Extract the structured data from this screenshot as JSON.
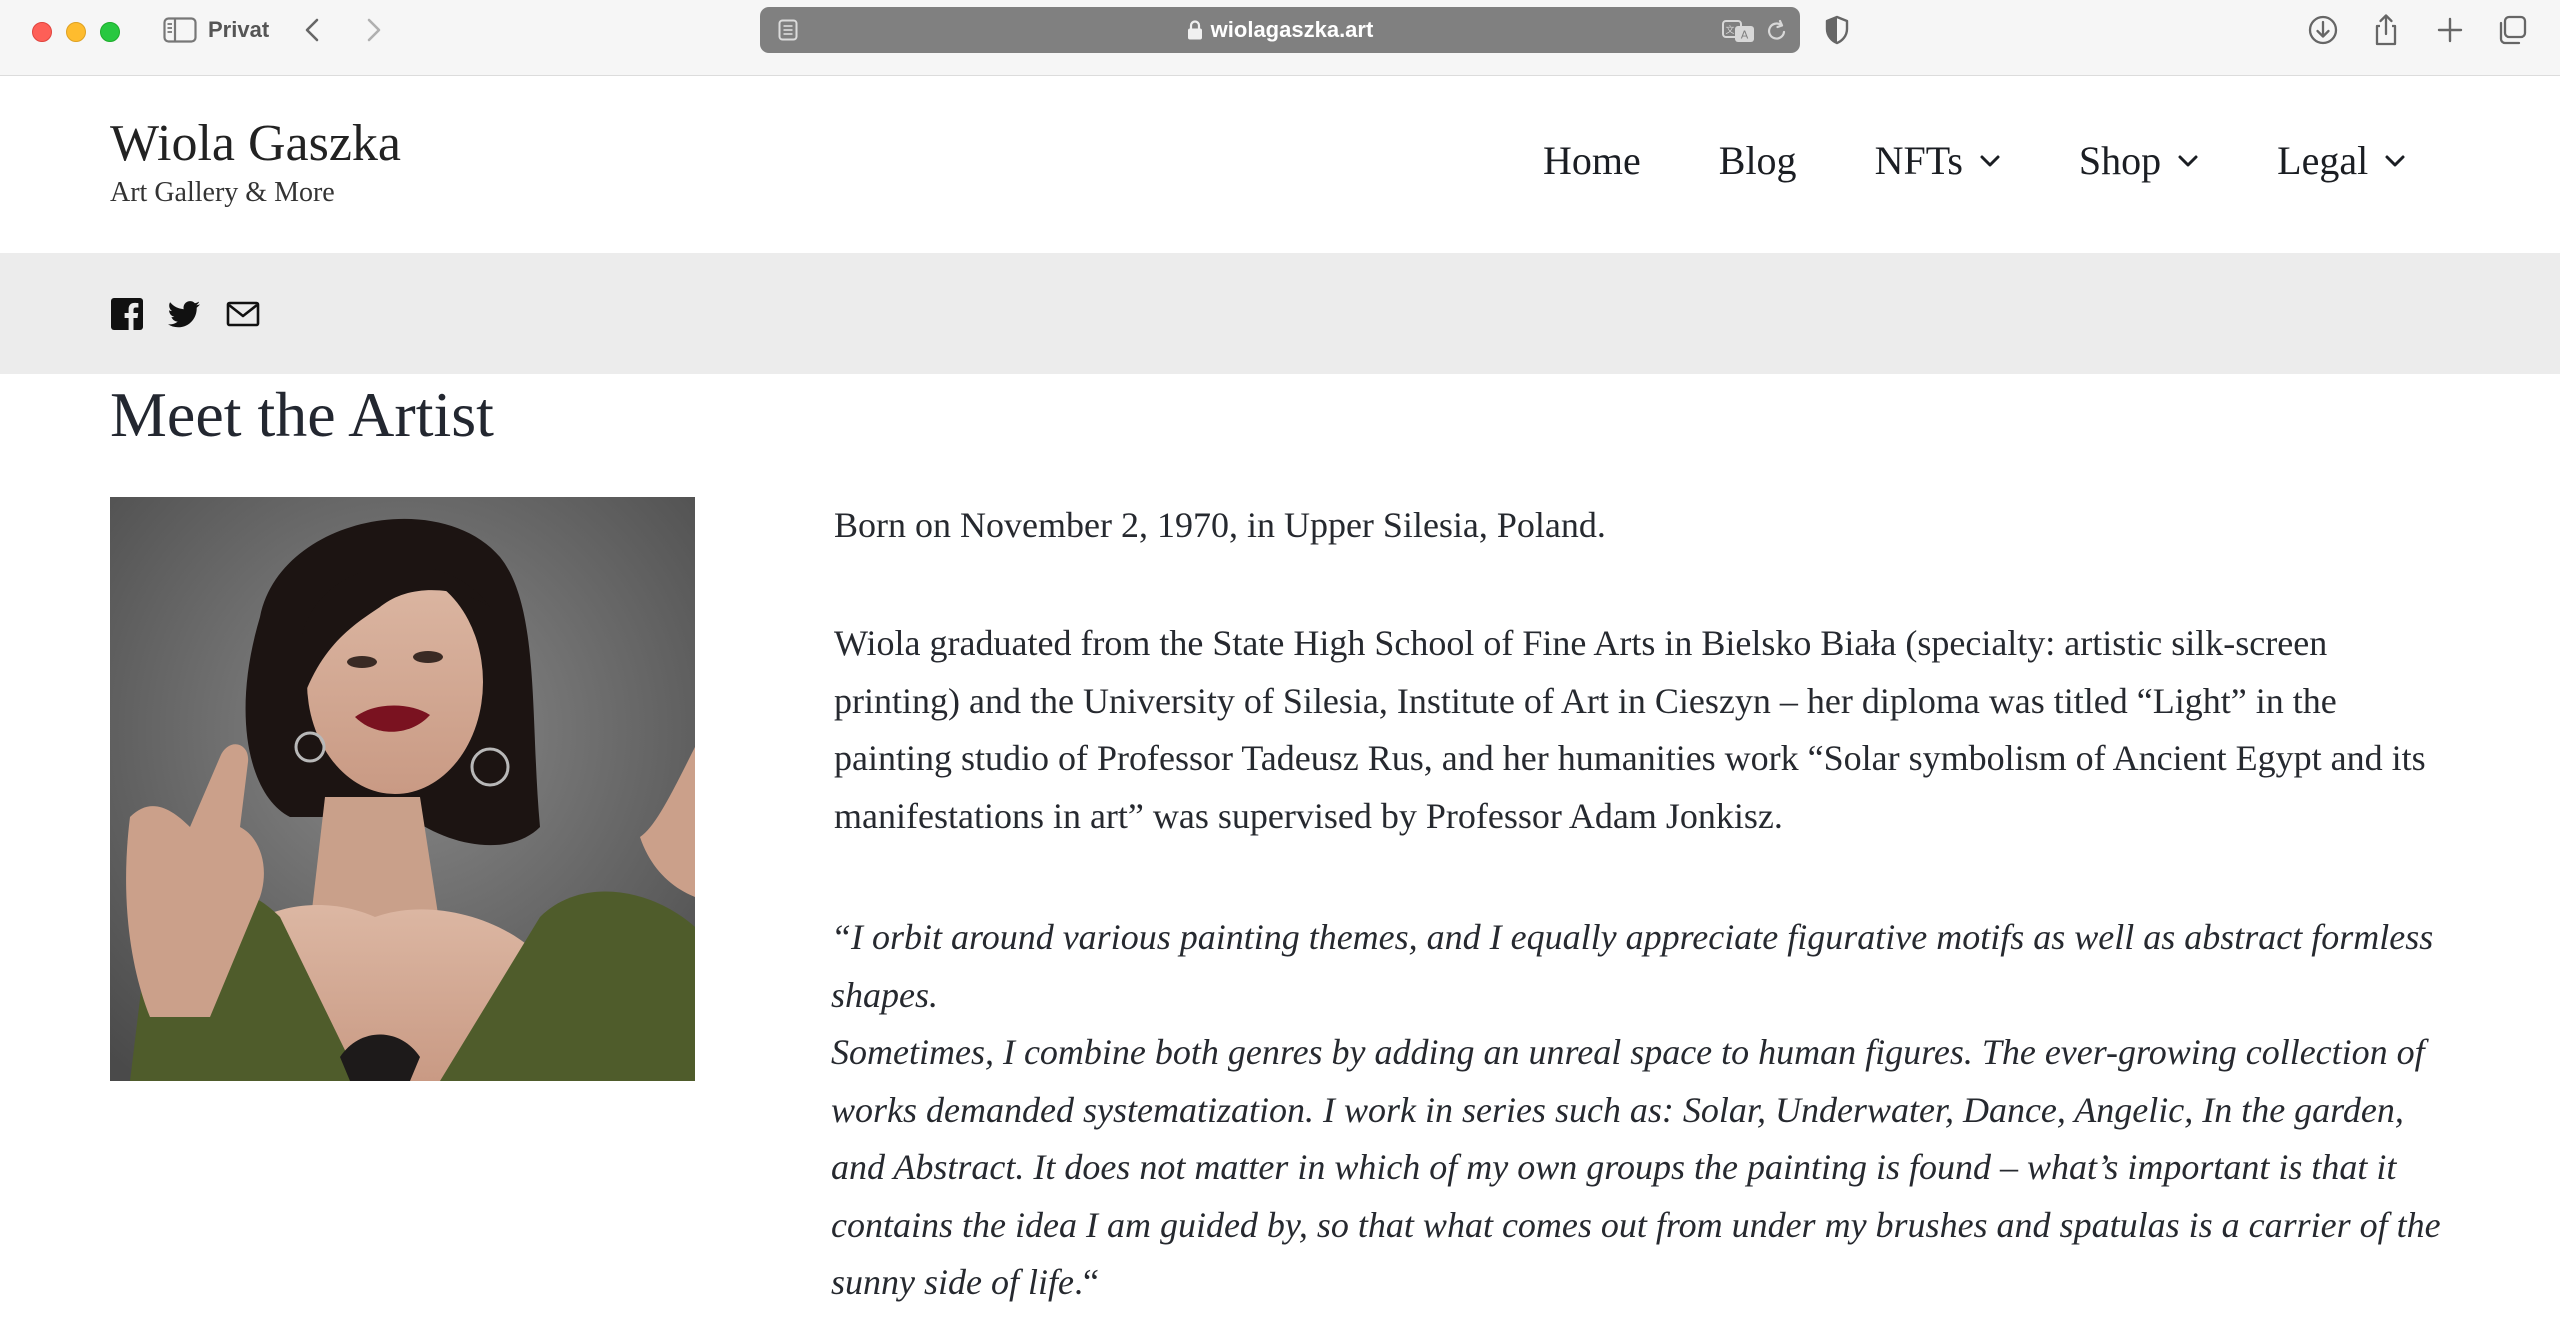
{
  "browser": {
    "profile_label": "Privat",
    "url": "wiolagaszka.art"
  },
  "site": {
    "title": "Wiola Gaszka",
    "tagline": "Art Gallery & More",
    "nav": [
      {
        "label": "Home",
        "dropdown": false
      },
      {
        "label": "Blog",
        "dropdown": false
      },
      {
        "label": "NFTs",
        "dropdown": true
      },
      {
        "label": "Shop",
        "dropdown": true
      },
      {
        "label": "Legal",
        "dropdown": true
      }
    ],
    "social": [
      "facebook-icon",
      "twitter-icon",
      "email-icon"
    ]
  },
  "page": {
    "title": "Meet the Artist",
    "born": "Born on November 2, 1970, in Upper Silesia, Poland.",
    "bio": "Wiola graduated from the State High School of Fine Arts in Bielsko Biała (specialty: artistic silk-screen printing) and the University of Silesia, Institute of Art in Cieszyn – her diploma was titled “Light” in the painting studio of Professor Tadeusz Rus, and her humanities work “Solar symbolism of Ancient Egypt and its manifestations in art” was supervised by Professor Adam Jonkisz.",
    "quote_1": "“I orbit around various painting themes, and I equally appreciate figurative motifs as well as abstract formless shapes.",
    "quote_2": "Sometimes, I combine both genres by adding an unreal space to human figures. The ever-growing collection of works demanded systematization. I work in series such as: Solar, Underwater, Dance, Angelic, In the garden, and Abstract. It does not matter in which of my own groups the painting is found – what’s important is that it contains the idea I am guided by, so that what comes out from under my brushes and spatulas is a carrier of the sunny side of life",
    "quote_end": ".“"
  },
  "colors": {
    "url_bar": "#808080",
    "social_bar": "#ececec",
    "text": "#26292f"
  }
}
